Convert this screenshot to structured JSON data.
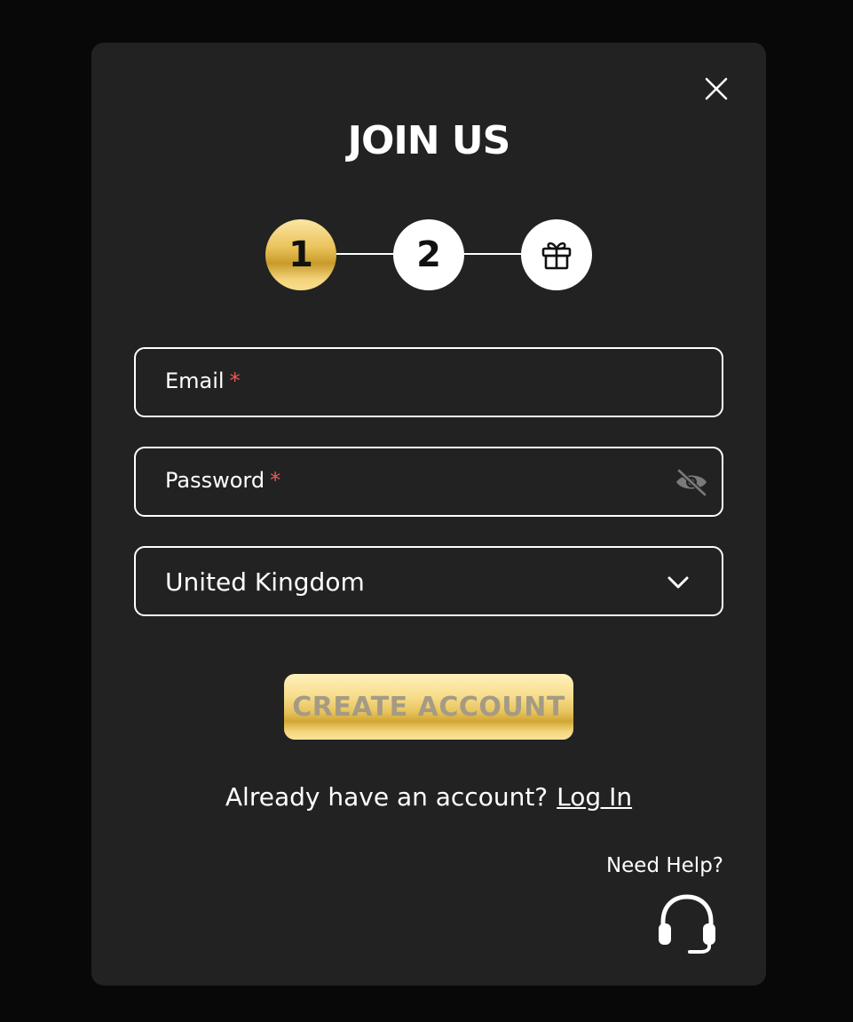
{
  "modal": {
    "title": "JOIN US",
    "close_icon": "close-icon"
  },
  "stepper": {
    "steps": [
      {
        "label": "1",
        "state": "active"
      },
      {
        "label": "2",
        "state": "inactive"
      },
      {
        "icon": "gift-icon",
        "state": "inactive"
      }
    ],
    "active_gradient": [
      "#fbe7a3",
      "#e9c25a",
      "#c89b2a",
      "#f7de8e"
    ]
  },
  "form": {
    "email": {
      "label": "Email",
      "required_mark": "*",
      "value": ""
    },
    "password": {
      "label": "Password",
      "required_mark": "*",
      "value": "",
      "toggle_icon": "eye-off-icon"
    },
    "country": {
      "selected": "United Kingdom",
      "icon": "chevron-down-icon"
    },
    "submit_label": "CREATE ACCOUNT"
  },
  "footer": {
    "login_prompt": "Already have an account?",
    "login_link": "Log In",
    "help_text": "Need Help?",
    "help_icon": "headset-icon"
  },
  "colors": {
    "modal_bg": "#222222",
    "page_bg": "#080808",
    "required": "#e35b5b",
    "button_text": "#a59b84"
  }
}
